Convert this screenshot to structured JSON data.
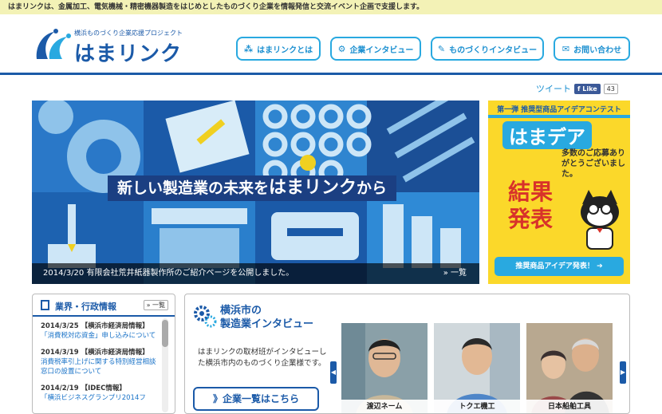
{
  "topbar": {
    "text": "はまリンクは、金属加工、電気機械・精密機器製造をはじめとしたものづくり企業を情報発信と交流イベント企画で支援します。"
  },
  "logo": {
    "sub": "横浜ものづくり企業応援プロジェクト",
    "main": "はまリンク"
  },
  "nav": [
    {
      "label": "はまリンクとは",
      "icon": "hamalink-icon"
    },
    {
      "label": "企業インタビュー",
      "icon": "gear-icon"
    },
    {
      "label": "ものづくりインタビュー",
      "icon": "pen-icon"
    },
    {
      "label": "お問い合わせ",
      "icon": "mail-icon"
    }
  ],
  "social": {
    "tweet": "ツイート",
    "like": "Like",
    "like_count": "43"
  },
  "hero": {
    "caption_a": "新しい製造業の未来を",
    "caption_b": "はまリンク",
    "caption_c": "から",
    "news": "2014/3/20 有限会社荒井紙器製作所のご紹介ページを公開しました。",
    "more": "» 一覧"
  },
  "banner": {
    "contest": "第一弾 推奨型商品アイデアコンテスト",
    "title": "はまデア",
    "thanks": "多数のご応募ありがとうございました。",
    "result": "結果発表",
    "button": "推奨商品アイデア発表！"
  },
  "news_panel": {
    "title": "業界・行政情報",
    "more": "» 一覧",
    "items": [
      {
        "meta": "2014/3/25 【横浜市経済局情報】",
        "link": "「消費税対応資金」申し込みについて"
      },
      {
        "meta": "2014/3/19 【横浜市経済局情報】",
        "link": "消費税率引上げに関する特別経営相談窓口の設置について"
      },
      {
        "meta": "2014/2/19 【IDEC情報】",
        "link": "「横浜ビジネスグランプリ2014フ"
      }
    ]
  },
  "interview": {
    "title_line1": "横浜市の",
    "title_line2": "製造業インタビュー",
    "desc": "はまリンクの取材班がインタビューした横浜市内のものづくり企業様です。",
    "button": "》企業一覧はこちら",
    "prev": "◀",
    "next": "▶",
    "cards": [
      {
        "name": "渡辺ネーム"
      },
      {
        "name": "トクエ機工"
      },
      {
        "name": "日本船舶工具"
      }
    ]
  }
}
